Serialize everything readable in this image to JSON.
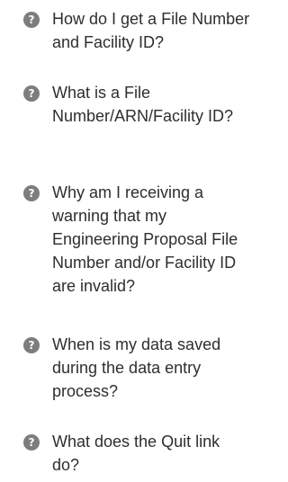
{
  "faq": {
    "icon": "question-circle-icon",
    "icon_glyph": "?",
    "questions": [
      "How do I get a File Number and Facility ID?",
      "What is a File Number/ARN/Facility ID?",
      "Why am I receiving a warning that my Engineering Proposal File Number and/or Facility ID are invalid?",
      "When is my data saved during the data entry process?",
      "What does the Quit link do?"
    ]
  }
}
